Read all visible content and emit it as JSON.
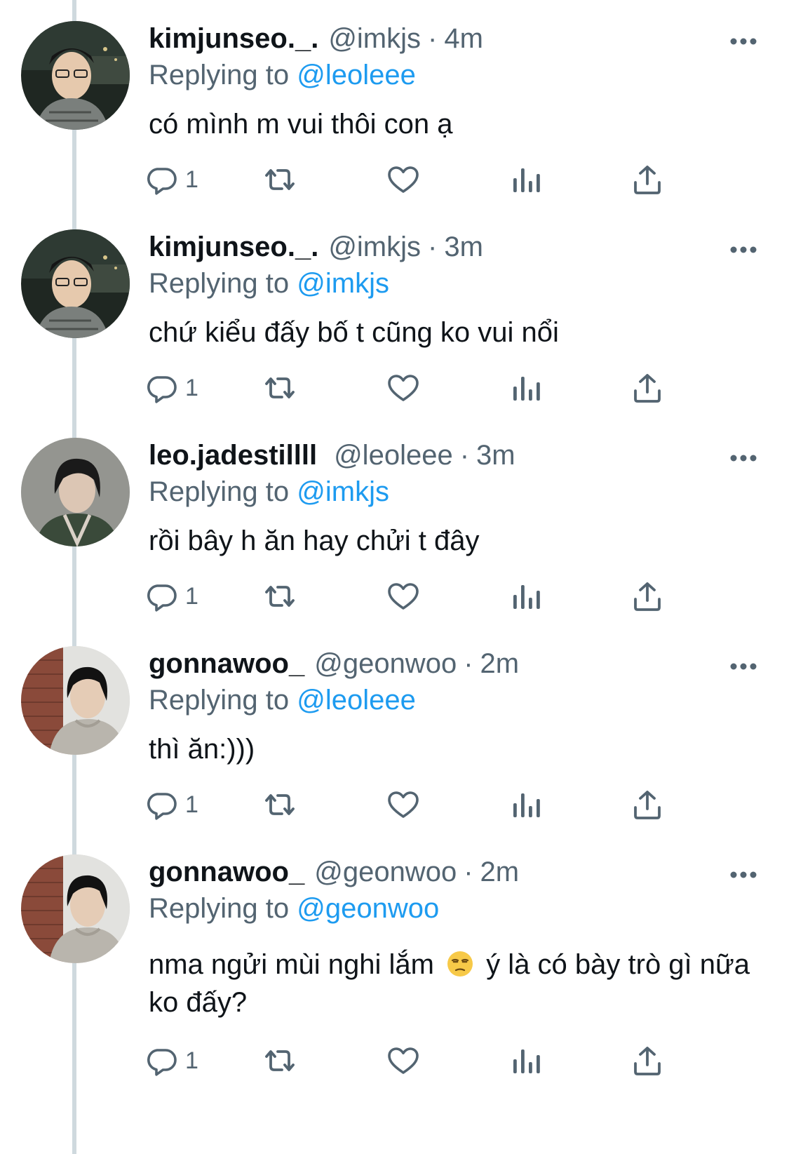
{
  "thread": {
    "tweets": [
      {
        "display_name": "kimjunseo._.",
        "handle": "@imkjs",
        "separator": "·",
        "time": "4m",
        "replying_prefix": "Replying to",
        "replying_to": "@leoleee",
        "text": "có mình m vui thôi con ạ",
        "reply_count": "1",
        "avatar": "kimjunseo-photo"
      },
      {
        "display_name": "kimjunseo._.",
        "handle": "@imkjs",
        "separator": "·",
        "time": "3m",
        "replying_prefix": "Replying to",
        "replying_to": "@imkjs",
        "text": "chứ kiểu đấy bố t cũng ko vui nổi",
        "reply_count": "1",
        "avatar": "kimjunseo-photo"
      },
      {
        "display_name": "leo.jadestillll",
        "handle": "@leoleee",
        "separator": "·",
        "time": "3m",
        "replying_prefix": "Replying to",
        "replying_to": "@imkjs",
        "text": "rồi bây h ăn hay chửi t đây",
        "reply_count": "1",
        "avatar": "leo-photo"
      },
      {
        "display_name": "gonnawoo_",
        "handle": "@geonwoo",
        "separator": "·",
        "time": "2m",
        "replying_prefix": "Replying to",
        "replying_to": "@leoleee",
        "text": "thì ăn:)))",
        "reply_count": "1",
        "avatar": "geonwoo-photo"
      },
      {
        "display_name": "gonnawoo_",
        "handle": "@geonwoo",
        "separator": "·",
        "time": "2m",
        "replying_prefix": "Replying to",
        "replying_to": "@geonwoo",
        "text_before_emoji": "nma ngửi mùi nghi lắm",
        "emoji": "unamused-face-emoji",
        "text_after_emoji": " ý là có bày trò gì nữa ko đấy?",
        "reply_count": "1",
        "avatar": "geonwoo-photo"
      }
    ]
  },
  "icons": {
    "more": "more-horizontal-icon",
    "reply": "reply-icon",
    "retweet": "retweet-icon",
    "like": "heart-icon",
    "views": "views-icon",
    "share": "share-icon"
  },
  "colors": {
    "text": "#0f1419",
    "secondary": "#536471",
    "mention": "#1d9bf0",
    "thread_line": "#cfd9de"
  }
}
